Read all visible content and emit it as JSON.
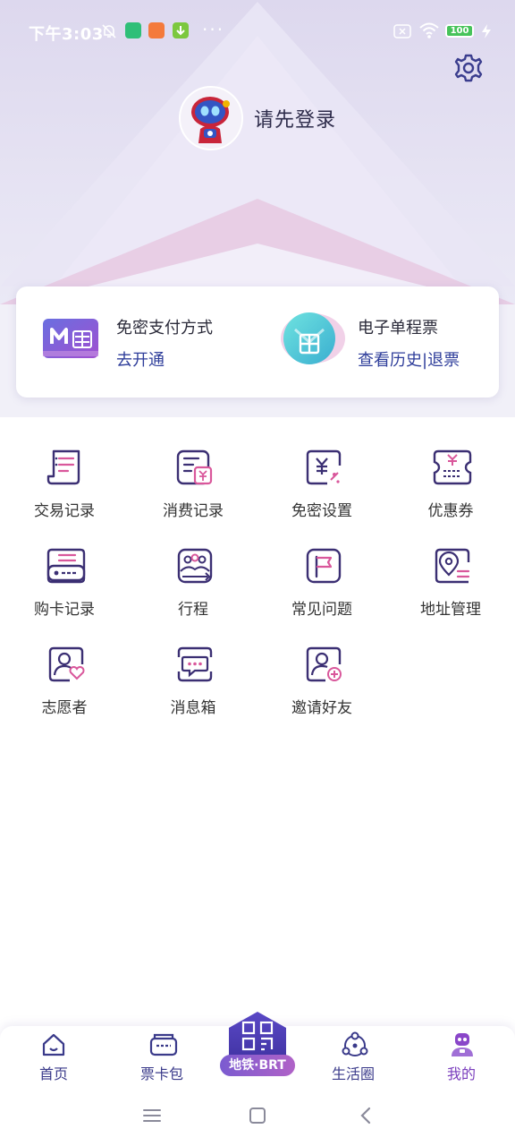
{
  "status_bar": {
    "time": "下午3:03",
    "battery": "100",
    "colors": {
      "green_app": "#2fbf78",
      "orange_app": "#f47a3b",
      "green_download": "#7cc83e"
    },
    "icons": [
      "mute-icon",
      "shield-app-icon",
      "bag-app-icon",
      "download-icon",
      "more-dots-icon",
      "no-sim-icon",
      "wifi-icon",
      "battery-icon",
      "charging-icon"
    ]
  },
  "header": {
    "login_prompt": "请先登录"
  },
  "card": {
    "left": {
      "title": "免密支付方式",
      "link": "去开通"
    },
    "right": {
      "title": "电子单程票",
      "link": "查看历史|退票"
    }
  },
  "grid": [
    {
      "label": "交易记录",
      "icon": "receipt-icon"
    },
    {
      "label": "消费记录",
      "icon": "bill-yen-icon"
    },
    {
      "label": "免密设置",
      "icon": "yen-card-icon"
    },
    {
      "label": "优惠券",
      "icon": "coupon-icon"
    },
    {
      "label": "购卡记录",
      "icon": "card-record-icon"
    },
    {
      "label": "行程",
      "icon": "people-trip-icon"
    },
    {
      "label": "常见问题",
      "icon": "flag-faq-icon"
    },
    {
      "label": "地址管理",
      "icon": "location-pin-icon"
    },
    {
      "label": "志愿者",
      "icon": "volunteer-heart-icon"
    },
    {
      "label": "消息箱",
      "icon": "message-box-icon"
    },
    {
      "label": "邀请好友",
      "icon": "invite-friend-icon"
    }
  ],
  "tabbar": {
    "tabs": [
      {
        "label": "首页",
        "icon": "home-icon"
      },
      {
        "label": "票卡包",
        "icon": "ticket-wallet-icon"
      },
      {
        "label": "生活圈",
        "icon": "life-circle-icon"
      },
      {
        "label": "我的",
        "icon": "robot-profile-icon"
      }
    ],
    "center": {
      "label": "地铁·BRT",
      "icon": "qr-code-icon"
    },
    "colors": {
      "default": "#3a3a8a",
      "active": "#7a3dbd"
    }
  },
  "colors": {
    "accent": "#2e3d9a",
    "icon_stroke": "#3b2f73",
    "icon_accent": "#d9579b"
  }
}
